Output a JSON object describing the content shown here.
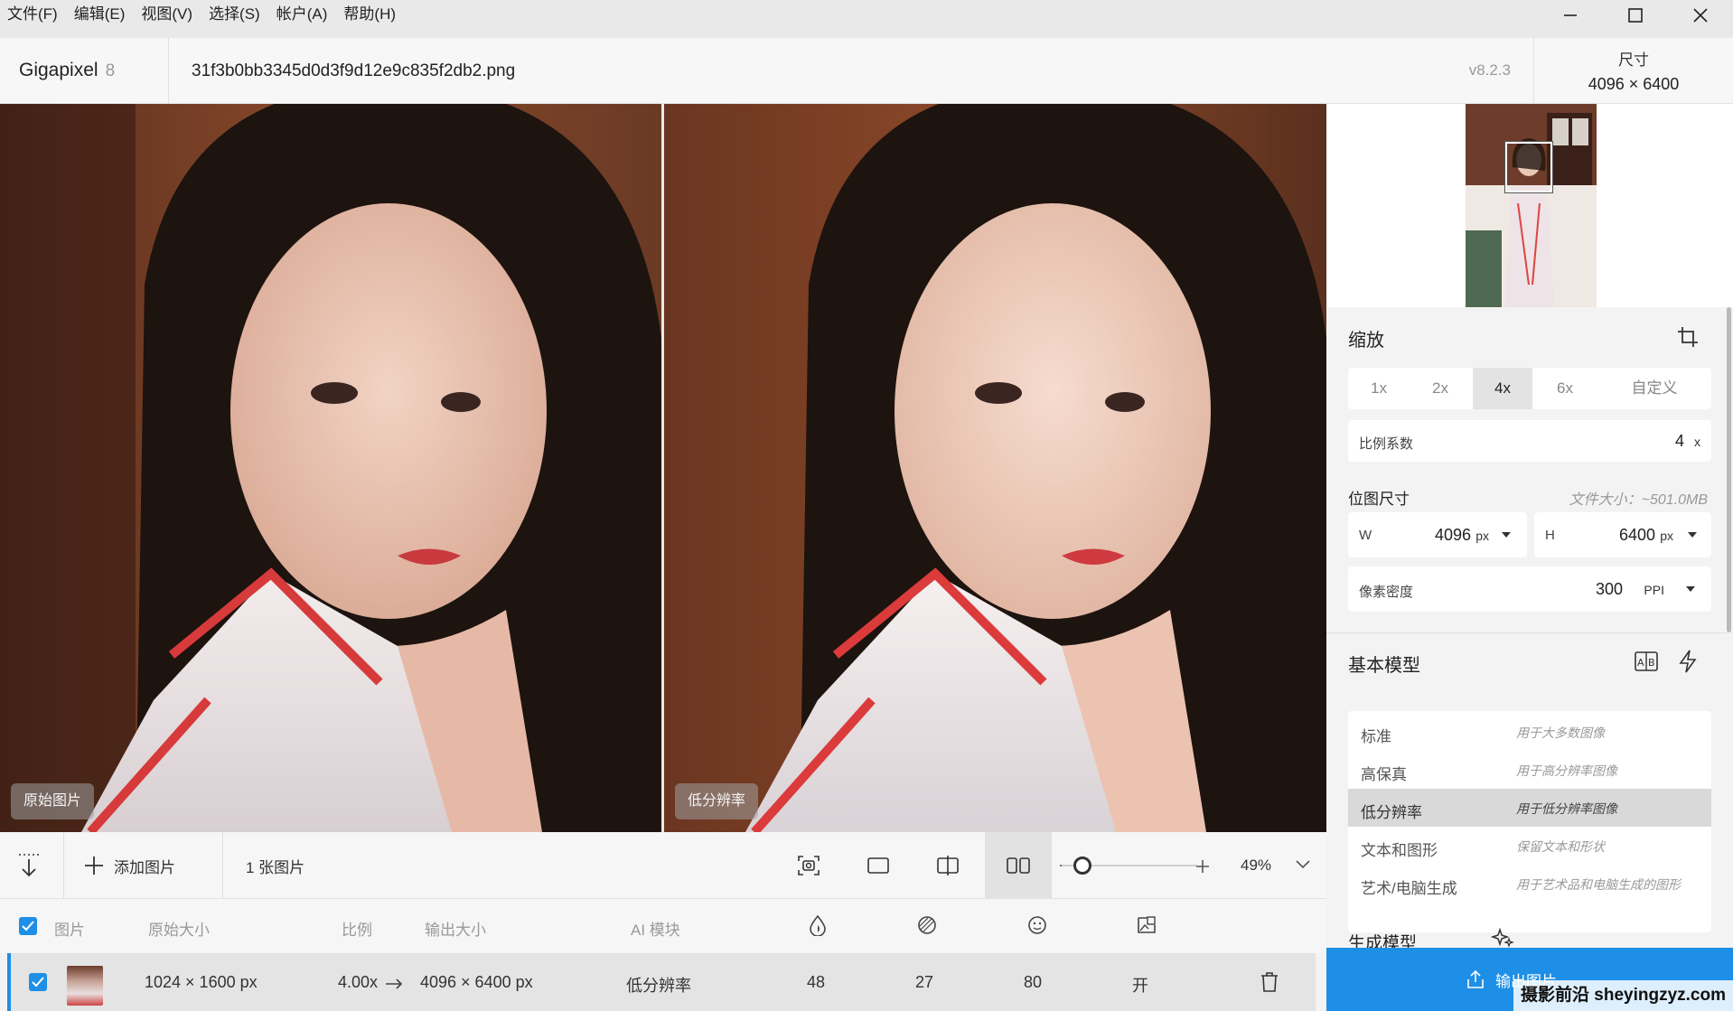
{
  "menu": [
    "文件(F)",
    "编辑(E)",
    "视图(V)",
    "选择(S)",
    "帐户(A)",
    "帮助(H)"
  ],
  "header": {
    "app_name": "Gigapixel",
    "app_major": "8",
    "filename": "31f3b0bb3345d0d3f9d12e9c835f2db2.png",
    "version": "v8.2.3",
    "size_label": "尺寸",
    "size_value": "4096 × 6400"
  },
  "viewer": {
    "left_label": "原始图片",
    "right_label": "低分辨率"
  },
  "toolbar": {
    "add_label": "添加图片",
    "count_label": "1 张图片",
    "zoom_value": "49%",
    "zoom_fraction": 0.15
  },
  "table": {
    "headers": {
      "image": "图片",
      "orig_size": "原始大小",
      "ratio": "比例",
      "out_size": "输出大小",
      "ai_model": "AI 模块"
    },
    "row": {
      "orig_size": "1024 × 1600 px",
      "ratio": "4.00x",
      "out_size": "4096 × 6400 px",
      "model": "低分辨率",
      "v1": "48",
      "v2": "27",
      "v3": "80",
      "v4": "开"
    }
  },
  "scale": {
    "title": "缩放",
    "options": [
      "1x",
      "2x",
      "4x",
      "6x",
      "自定义"
    ],
    "selected": "4x",
    "factor_label": "比例系数",
    "factor_value": "4",
    "factor_unit": "x"
  },
  "bitmap": {
    "title": "位图尺寸",
    "file_size": "文件大小：~501.0MB",
    "w_label": "W",
    "w_value": "4096",
    "h_label": "H",
    "h_value": "6400",
    "unit": "px",
    "ppi_label": "像素密度",
    "ppi_value": "300",
    "ppi_unit": "PPI"
  },
  "model": {
    "title": "基本模型",
    "items": [
      {
        "name": "标准",
        "desc": "用于大多数图像"
      },
      {
        "name": "高保真",
        "desc": "用于高分辨率图像"
      },
      {
        "name": "低分辨率",
        "desc": "用于低分辨率图像"
      },
      {
        "name": "文本和图形",
        "desc": "保留文本和形状"
      },
      {
        "name": "艺术/电脑生成",
        "desc": "用于艺术品和电脑生成的图形"
      }
    ],
    "selected": "低分辨率",
    "gen_title": "生成模型"
  },
  "export": {
    "label": "输出图片"
  },
  "watermark": "摄影前沿 sheyingzyz.com",
  "colors": {
    "accent": "#1e8fe6",
    "selected_bg": "#d9d9d9"
  }
}
